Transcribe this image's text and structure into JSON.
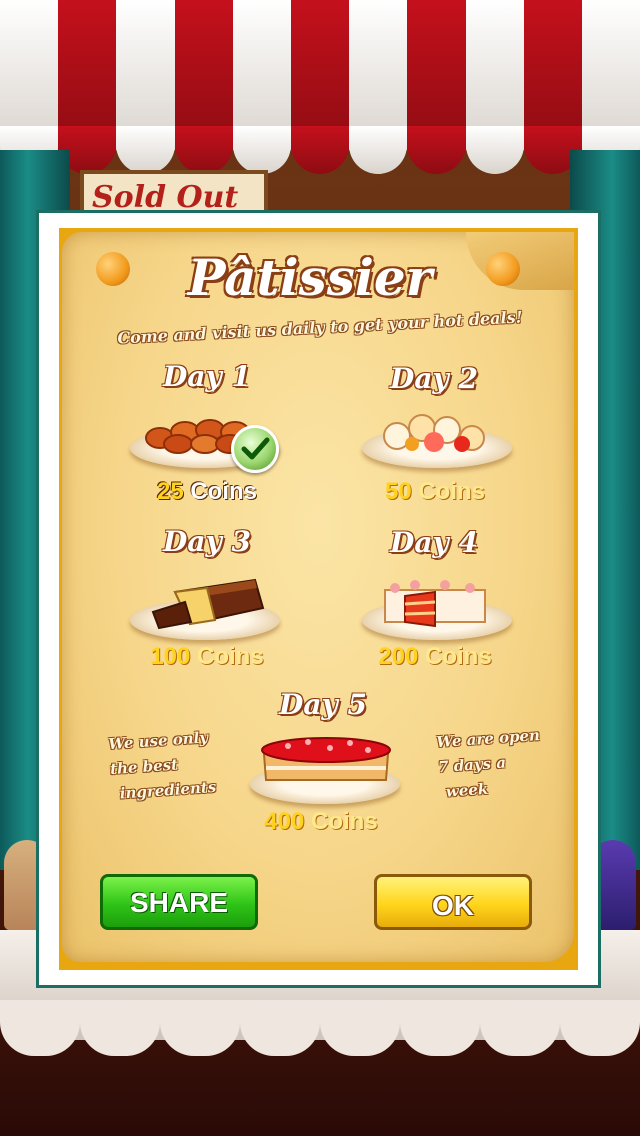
{
  "background": {
    "sign_text": "Sold Out"
  },
  "popup": {
    "title": "Pâtissier",
    "subtitle": "Come and visit us daily to get your hot deals!",
    "days": [
      {
        "label": "Day 1",
        "coins_value": "25",
        "coins_word": "Coins",
        "claimed": true,
        "food": "cookies-icon"
      },
      {
        "label": "Day 2",
        "coins_value": "50",
        "coins_word": "Coins",
        "claimed": false,
        "food": "cream-puffs-icon"
      },
      {
        "label": "Day 3",
        "coins_value": "100",
        "coins_word": "Coins",
        "claimed": false,
        "food": "loaf-cake-icon"
      },
      {
        "label": "Day 4",
        "coins_value": "200",
        "coins_word": "Coins",
        "claimed": false,
        "food": "layer-cake-icon"
      },
      {
        "label": "Day 5",
        "coins_value": "400",
        "coins_word": "Coins",
        "claimed": false,
        "food": "berry-tart-icon"
      }
    ],
    "note_left": [
      "We use only",
      "the best",
      "ingredients"
    ],
    "note_right": [
      "We are open",
      "7 days a",
      "week"
    ],
    "share_label": "SHARE",
    "ok_label": "OK"
  },
  "colors": {
    "frame_border": "#1a6e64",
    "parchment": "#f6d68a",
    "coin_yellow": "#ffd21e",
    "share_green": "#2ec417",
    "ok_yellow": "#ffd51c"
  }
}
